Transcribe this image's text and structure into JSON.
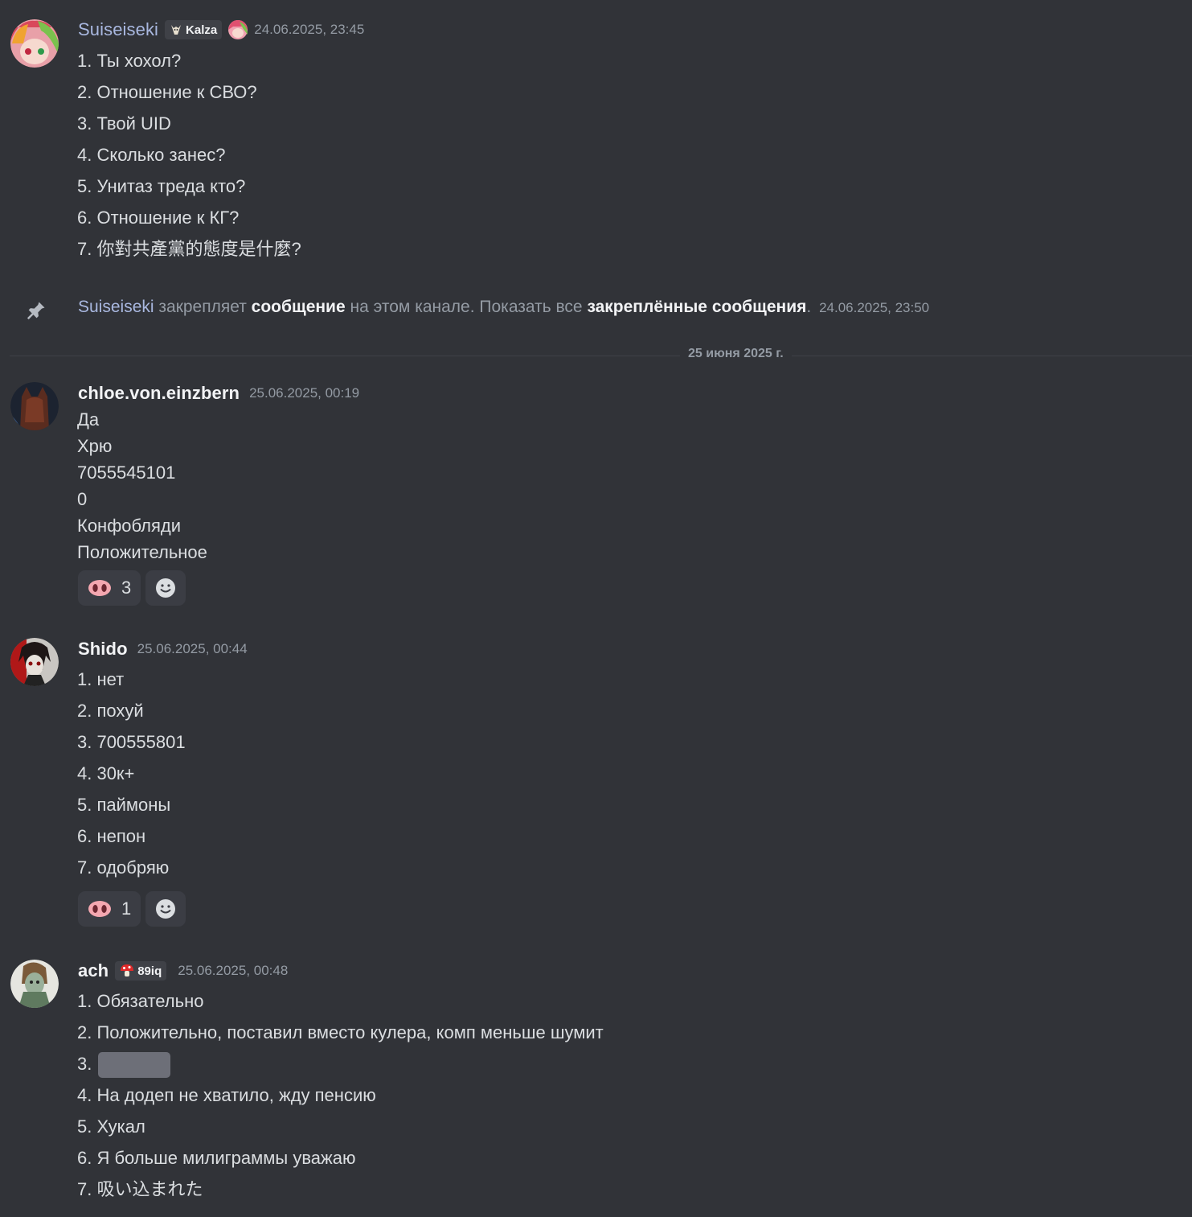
{
  "messages": [
    {
      "username": "Suiseiseki",
      "tag": "Kalza",
      "timestamp": "24.06.2025, 23:45",
      "lines": [
        "1. Ты хохол?",
        "2. Отношение к СВО?",
        "3. Твой UID",
        "4. Сколько занес?",
        "5. Унитаз треда кто?",
        "6. Отношение к КГ?",
        "7. 你對共產黨的態度是什麼?"
      ]
    },
    {
      "username": "chloe.von.einzbern",
      "timestamp": "25.06.2025, 00:19",
      "lines": [
        "Да",
        "Хрю",
        "7055545101",
        "0",
        "Конфобляди",
        "Положительное"
      ],
      "reaction_count": "3"
    },
    {
      "username": "Shido",
      "timestamp": "25.06.2025, 00:44",
      "lines": [
        "1. нет",
        "2. похуй",
        "3. 700555801",
        "4. 30к+",
        "5. паймоны",
        "6. непон",
        "7. одобряю"
      ],
      "reaction_count": "1"
    },
    {
      "username": "ach",
      "tag": "89iq",
      "timestamp": "25.06.2025, 00:48",
      "lines": [
        "1. Обязательно",
        "2. Положительно, поставил вместо кулера, комп меньше шумит",
        "3.",
        "4. На додеп не хватило, жду пенсию",
        "5. Хукал",
        "6. Я больше милиграммы уважаю",
        "7. 吸い込まれた"
      ]
    }
  ],
  "pin_notice": {
    "user": "Suiseiseki",
    "t1": " закрепляет ",
    "b1": "сообщение",
    "t2": " на этом канале. Показать все ",
    "b2": "закреплённые сообщения",
    "t3": ".",
    "timestamp": "24.06.2025, 23:50"
  },
  "date_divider": "25 июня 2025 г.",
  "colors": {
    "background": "#313338",
    "username_blue": "#a9b8e0",
    "muted": "#949ba4",
    "text": "#dbdee1"
  }
}
